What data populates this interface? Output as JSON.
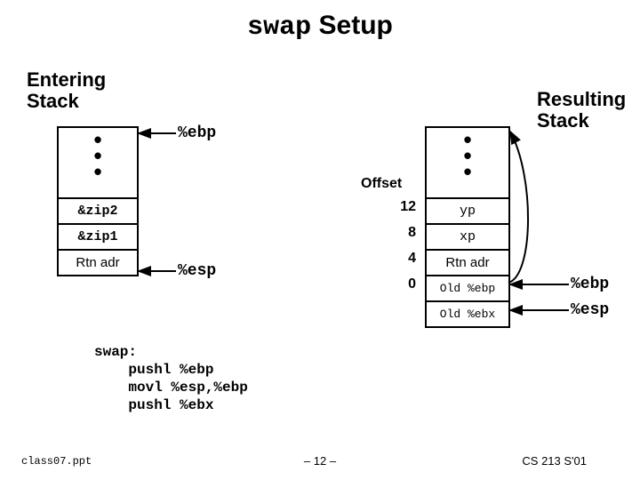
{
  "title": {
    "kw": "swap",
    "rest": " Setup"
  },
  "labels": {
    "entering": "Entering\nStack",
    "resulting": "Resulting\nStack",
    "offset": "Offset",
    "ebp": "%ebp",
    "esp": "%esp"
  },
  "left_stack": {
    "rows": [
      "&zip2",
      "&zip1",
      "Rtn adr"
    ]
  },
  "right_stack": {
    "rows": [
      "yp",
      "xp",
      "Rtn adr",
      "Old %ebp",
      "Old %ebx"
    ]
  },
  "offsets": [
    "12",
    "8",
    "4",
    "0"
  ],
  "right_pointers": {
    "ebp": "%ebp",
    "esp": "%esp"
  },
  "code": "swap:\n    pushl %ebp\n    movl %esp,%ebp\n    pushl %ebx",
  "footer": {
    "left": "class07.ppt",
    "center": "– 12 –",
    "right": "CS 213 S'01"
  },
  "chart_data": {
    "type": "table",
    "title": "swap Setup",
    "left_stack": {
      "pointer_top": "%ebp",
      "cells": [
        "&zip2",
        "&zip1",
        "Rtn adr"
      ],
      "pointer_bottom": "%esp"
    },
    "right_stack": {
      "cells": [
        {
          "offset": 12,
          "value": "yp"
        },
        {
          "offset": 8,
          "value": "xp"
        },
        {
          "offset": 4,
          "value": "Rtn adr"
        },
        {
          "offset": 0,
          "value": "Old %ebp",
          "pointer": "%ebp"
        },
        {
          "offset": null,
          "value": "Old %ebx",
          "pointer": "%esp"
        }
      ]
    },
    "assembly": [
      "swap:",
      "pushl %ebp",
      "movl %esp,%ebp",
      "pushl %ebx"
    ]
  }
}
